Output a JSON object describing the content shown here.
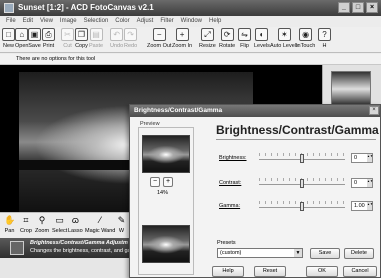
{
  "window": {
    "title": "Sunset [1:2] - ACD FotoCanvas v2.1",
    "controls": [
      "_",
      "□",
      "×"
    ]
  },
  "menu": [
    "File",
    "Edit",
    "View",
    "Image",
    "Selection",
    "Color",
    "Adjust",
    "Filter",
    "Window",
    "Help"
  ],
  "toolbar": [
    {
      "label": "New",
      "icon": "new-document-icon",
      "glyph": "□",
      "enabled": true
    },
    {
      "label": "Open",
      "icon": "open-folder-icon",
      "glyph": "⌂",
      "enabled": true
    },
    {
      "label": "Save",
      "icon": "floppy-disk-icon",
      "glyph": "▣",
      "enabled": true
    },
    {
      "label": "Print",
      "icon": "printer-icon",
      "glyph": "⎙",
      "enabled": true
    },
    {
      "label": "Cut",
      "icon": "scissors-icon",
      "glyph": "✂",
      "enabled": false
    },
    {
      "label": "Copy",
      "icon": "copy-icon",
      "glyph": "❐",
      "enabled": true
    },
    {
      "label": "Paste",
      "icon": "paste-icon",
      "glyph": "▤",
      "enabled": false
    },
    {
      "label": "Undo",
      "icon": "undo-icon",
      "glyph": "↶",
      "enabled": false
    },
    {
      "label": "Redo",
      "icon": "redo-icon",
      "glyph": "↷",
      "enabled": false
    },
    {
      "label": "Zoom Out",
      "icon": "zoom-out-icon",
      "glyph": "−",
      "enabled": true
    },
    {
      "label": "Zoom In",
      "icon": "zoom-in-icon",
      "glyph": "+",
      "enabled": true
    },
    {
      "label": "Resize",
      "icon": "resize-icon",
      "glyph": "⤢",
      "enabled": true
    },
    {
      "label": "Rotate",
      "icon": "rotate-icon",
      "glyph": "⟳",
      "enabled": true
    },
    {
      "label": "Flip",
      "icon": "flip-icon",
      "glyph": "⇋",
      "enabled": true
    },
    {
      "label": "Levels",
      "icon": "levels-icon",
      "glyph": "◐",
      "enabled": true
    },
    {
      "label": "Auto Levels",
      "icon": "auto-levels-icon",
      "glyph": "✶",
      "enabled": true
    },
    {
      "label": "InTouch",
      "icon": "intouch-icon",
      "glyph": "◉",
      "enabled": true
    },
    {
      "label": "H",
      "icon": "help-icon",
      "glyph": "?",
      "enabled": true
    }
  ],
  "options_bar": "There are no options for this tool",
  "tools": [
    {
      "label": "Pan",
      "icon": "hand-icon",
      "glyph": "✋"
    },
    {
      "label": "Crop",
      "icon": "crop-icon",
      "glyph": "⌗"
    },
    {
      "label": "Zoom",
      "icon": "magnifier-icon",
      "glyph": "⚲"
    },
    {
      "label": "Select",
      "icon": "select-rectangle-icon",
      "glyph": "▭"
    },
    {
      "label": "Lasso",
      "icon": "lasso-icon",
      "glyph": "ɷ"
    },
    {
      "label": "Magic Wand",
      "icon": "magic-wand-icon",
      "glyph": "⁄"
    },
    {
      "label": "W",
      "icon": "brush-icon",
      "glyph": "✎"
    }
  ],
  "status": {
    "title": "Brightness/Contrast/Gamma Adjustm",
    "description": "Changes the brightness, contrast, and gamm"
  },
  "dialog": {
    "title": "Brightness/Contrast/Gamma",
    "heading": "Brightness/Contrast/Gamma",
    "preview_label": "Preview",
    "zoom": "14%",
    "sliders": [
      {
        "label": "Brightness:",
        "value": "0",
        "level": 0.5
      },
      {
        "label": "Contrast:",
        "value": "0",
        "level": 0.5
      },
      {
        "label": "Gamma:",
        "value": "1.00",
        "level": 0.5
      }
    ],
    "presets_label": "Presets",
    "preset_value": "(custom)",
    "buttons": {
      "save": "Save",
      "delete": "Delete",
      "help": "Help",
      "reset": "Reset",
      "ok": "OK",
      "cancel": "Cancel"
    }
  }
}
